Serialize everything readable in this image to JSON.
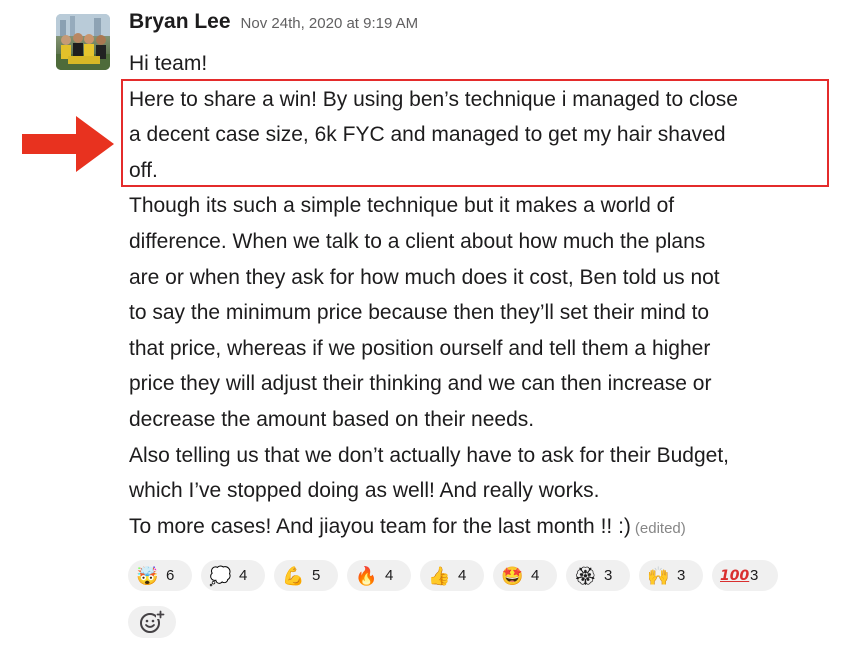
{
  "message": {
    "sender": "Bryan Lee",
    "timestamp": "Nov 24th, 2020 at 9:19 AM",
    "lines": [
      "Hi team!",
      "Here to share a win! By using ben’s technique i managed to close",
      "a decent case size, 6k FYC and managed to get my hair shaved",
      "off.",
      "Though its such a simple technique but it makes a world of",
      "difference. When we talk to a client about how much the plans",
      "are or when they ask for how much does it cost, Ben told us not",
      "to say the minimum price because then they’ll set their mind to",
      "that price, whereas if we position ourself and tell them a higher",
      "price they will adjust their thinking and we can then increase or",
      "decrease the amount based on their needs.",
      "Also telling us that we don’t actually have to ask for their Budget,",
      "which I’ve stopped doing as well! And really works.",
      "To more cases! And jiayou team for the last month !! :)"
    ],
    "edited_label": "(edited)"
  },
  "reactions": [
    {
      "icon": "exploding-head-icon",
      "glyph": "🤯",
      "count": "6"
    },
    {
      "icon": "thinking-bulb-icon",
      "glyph": "💭",
      "count": "4"
    },
    {
      "icon": "flexed-biceps-icon",
      "glyph": "💪",
      "count": "5"
    },
    {
      "icon": "fire-icon",
      "glyph": "🔥",
      "count": "4"
    },
    {
      "icon": "thumbs-up-icon",
      "glyph": "👍",
      "count": "4"
    },
    {
      "icon": "star-struck-icon",
      "glyph": "🤩",
      "count": "4"
    },
    {
      "icon": "rosette-icon",
      "glyph": "🏵",
      "count": "3"
    },
    {
      "icon": "raised-hands-icon",
      "glyph": "🙌",
      "count": "3"
    },
    {
      "icon": "hundred-points-icon",
      "glyph": "100",
      "count": "3"
    }
  ],
  "colors": {
    "highlight_border": "#e42b2b",
    "arrow": "#e8321f",
    "reaction_bg": "#f0f0f0",
    "timestamp": "#616061"
  }
}
